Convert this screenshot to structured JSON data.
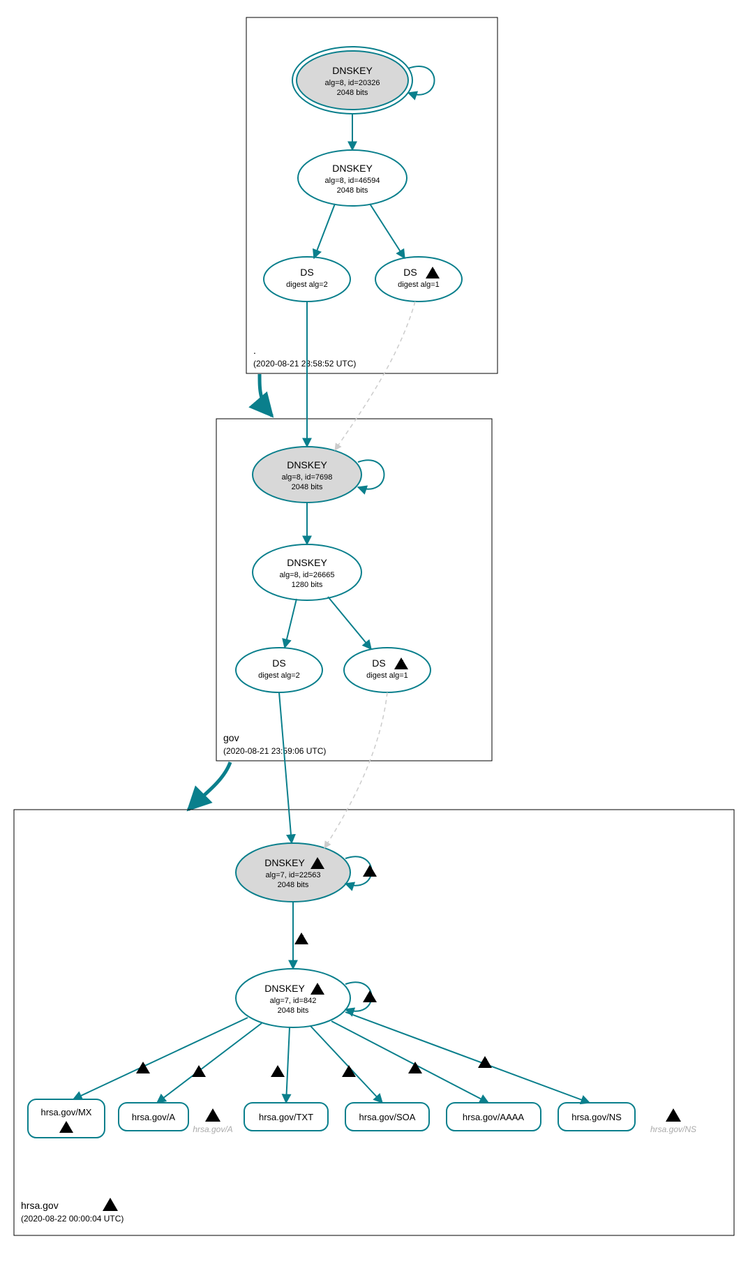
{
  "zones": {
    "root": {
      "name": ".",
      "timestamp": "(2020-08-21 23:58:52 UTC)"
    },
    "gov": {
      "name": "gov",
      "timestamp": "(2020-08-21 23:59:06 UTC)"
    },
    "hrsa": {
      "name": "hrsa.gov",
      "timestamp": "(2020-08-22 00:00:04 UTC)"
    }
  },
  "nodes": {
    "root_ksk": {
      "title": "DNSKEY",
      "sub1": "alg=8, id=20326",
      "sub2": "2048 bits"
    },
    "root_zsk": {
      "title": "DNSKEY",
      "sub1": "alg=8, id=46594",
      "sub2": "2048 bits"
    },
    "root_ds_a": {
      "title": "DS",
      "sub1": "digest alg=2"
    },
    "root_ds_b": {
      "title": "DS",
      "sub1": "digest alg=1"
    },
    "gov_ksk": {
      "title": "DNSKEY",
      "sub1": "alg=8, id=7698",
      "sub2": "2048 bits"
    },
    "gov_zsk": {
      "title": "DNSKEY",
      "sub1": "alg=8, id=26665",
      "sub2": "1280 bits"
    },
    "gov_ds_a": {
      "title": "DS",
      "sub1": "digest alg=2"
    },
    "gov_ds_b": {
      "title": "DS",
      "sub1": "digest alg=1"
    },
    "hrsa_ksk": {
      "title": "DNSKEY",
      "sub1": "alg=7, id=22563",
      "sub2": "2048 bits"
    },
    "hrsa_zsk": {
      "title": "DNSKEY",
      "sub1": "alg=7, id=842",
      "sub2": "2048 bits"
    }
  },
  "rrsets": {
    "mx": "hrsa.gov/MX",
    "a": "hrsa.gov/A",
    "txt": "hrsa.gov/TXT",
    "soa": "hrsa.gov/SOA",
    "aaaa": "hrsa.gov/AAAA",
    "ns": "hrsa.gov/NS"
  },
  "nx": {
    "a": "hrsa.gov/A",
    "ns": "hrsa.gov/NS"
  }
}
